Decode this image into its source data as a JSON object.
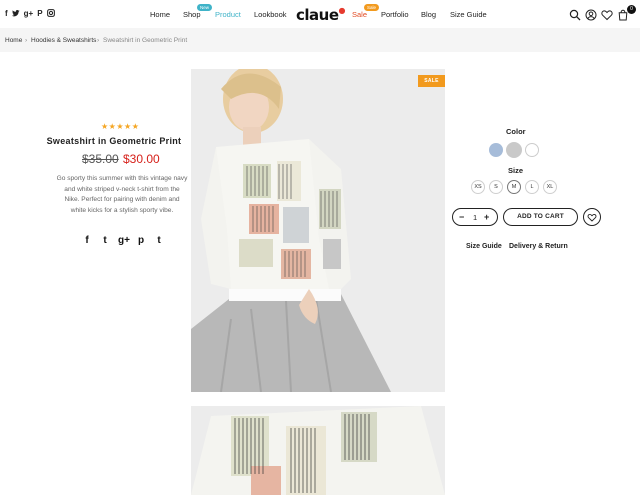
{
  "header": {
    "social": [
      "f",
      "𝕥",
      "g+",
      "P",
      "◙"
    ],
    "nav": {
      "home": "Home",
      "shop": "Shop",
      "shop_badge": "New",
      "product": "Product",
      "lookbook": "Lookbook",
      "sale": "Sale",
      "sale_badge": "Sale",
      "portfolio": "Portfolio",
      "blog": "Blog",
      "size_guide": "Size Guide"
    },
    "logo": "claue",
    "cart_count": "0"
  },
  "breadcrumb": {
    "home": "Home",
    "category": "Hoodies & Sweatshirts",
    "current": "Sweatshirt in Geometric Print",
    "separator": "›"
  },
  "product": {
    "rating": "★★★★★",
    "title": "Sweatshirt in Geometric Print",
    "old_price": "$35.00",
    "new_price": "$30.00",
    "description": "Go sporty this summer with this vintage navy and white striped v-neck t-shirt from the Nike. Perfect for pairing with denim and white kicks for a stylish sporty vibe.",
    "share": [
      "f",
      "t",
      "g+",
      "p",
      "t"
    ],
    "image_badge": "SALE"
  },
  "options": {
    "color_label": "Color",
    "colors": [
      "#a6bcd9",
      "#c9c9c9",
      "#ffffff"
    ],
    "size_label": "Size",
    "sizes": [
      "XS",
      "S",
      "M",
      "L",
      "XL"
    ],
    "selected_size": "M"
  },
  "cart": {
    "minus": "−",
    "quantity": "1",
    "plus": "+",
    "add_to_cart": "ADD TO CART"
  },
  "links": {
    "size_guide": "Size Guide",
    "delivery": "Delivery & Return"
  }
}
